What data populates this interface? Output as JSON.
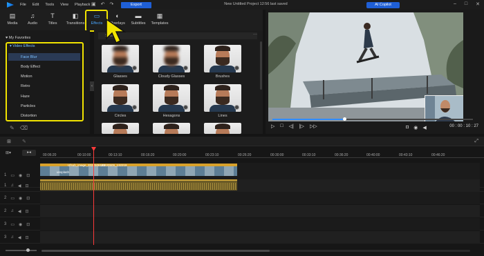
{
  "menu": [
    "File",
    "Edit",
    "Tools",
    "View",
    "Playback"
  ],
  "toolbar": {
    "export_label": "Export",
    "ai_copilot_label": "AI Copilot"
  },
  "project_title": "New Untitled Project  12:56 last saved",
  "tabs": [
    {
      "label": "Media",
      "icon": "media-icon"
    },
    {
      "label": "Audio",
      "icon": "music-note-icon"
    },
    {
      "label": "Titles",
      "icon": "titles-icon"
    },
    {
      "label": "Transitions",
      "icon": "transitions-icon"
    },
    {
      "label": "Effects",
      "icon": "effects-icon"
    },
    {
      "label": "Overlays",
      "icon": "overlays-icon"
    },
    {
      "label": "Subtitles",
      "icon": "subtitles-icon"
    },
    {
      "label": "Templates",
      "icon": "templates-icon"
    }
  ],
  "active_tab": "Effects",
  "tree": {
    "favorites_label": "My Favorites",
    "category_label": "Video Effects",
    "items": [
      "Face Blur",
      "Body Effect",
      "Motion",
      "Retro",
      "Haze",
      "Particles",
      "Distortion"
    ],
    "selected": "Face Blur"
  },
  "search": {
    "placeholder": "Search"
  },
  "effects": [
    {
      "label": "Glasses"
    },
    {
      "label": "Cloudy Glasses"
    },
    {
      "label": "Brushes"
    },
    {
      "label": "Circles"
    },
    {
      "label": "Hexagons"
    },
    {
      "label": "Lines"
    }
  ],
  "preview": {
    "timecode": "00 : 00 : 10 : 27",
    "progress": 0.36
  },
  "timeline": {
    "ticks": [
      "00:06:20",
      "00:10:00",
      "00:13:10",
      "00:16:20",
      "00:20:00",
      "00:23:10",
      "00:26:20",
      "00:30:00",
      "00:33:10",
      "00:36:20",
      "00:40:00",
      "00:43:10",
      "00:46:20"
    ],
    "track_numbers": [
      "1",
      "1",
      "2",
      "2",
      "3",
      "3"
    ],
    "clip_labels": [
      "unsplash",
      "Ufsub_image_2022508144",
      "20220509_132218"
    ]
  },
  "colors": {
    "accent": "#1f5fd6",
    "highlight": "#f2e400",
    "playhead": "#ff3b3b"
  }
}
